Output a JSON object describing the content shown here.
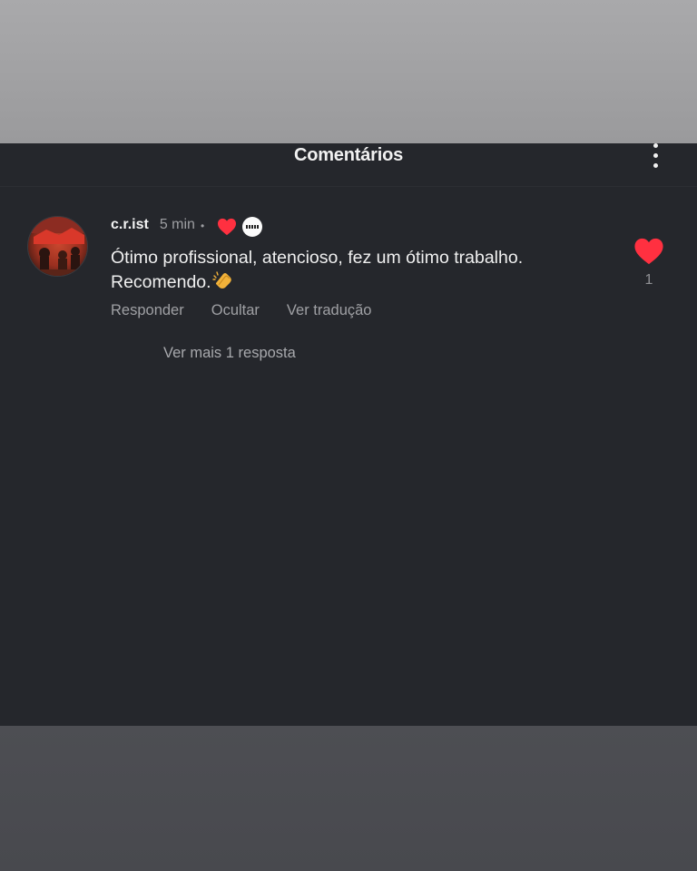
{
  "header": {
    "title": "Comentários",
    "more_icon": "more-vertical-icon"
  },
  "comment": {
    "username": "c.r.ist",
    "time": "5 min",
    "separator": "•",
    "author_liked_icon": "heart-icon",
    "author_badge_icon": "author-avatar-badge",
    "text_line1": "Ótimo profissional, atencioso, fez um ótimo trabalho.",
    "text_line2": "Recomendo.",
    "emoji": "clapping-hands-icon",
    "like_count": "1",
    "like_color": "#ff3040",
    "actions": {
      "reply": "Responder",
      "hide": "Ocultar",
      "translate": "Ver tradução"
    },
    "more_replies": "Ver mais 1 resposta"
  },
  "colors": {
    "background": "#25272c",
    "text_primary": "#f0f0f0",
    "text_secondary": "#9fa0a4",
    "heart": "#ff3040"
  }
}
